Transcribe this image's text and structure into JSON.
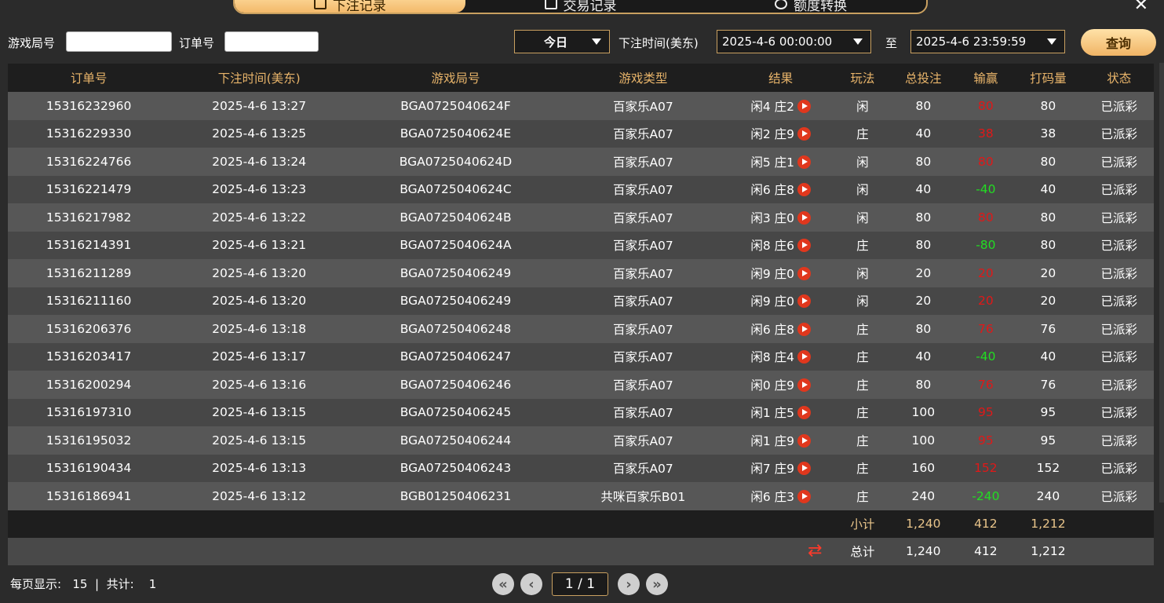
{
  "tabs": [
    {
      "label": "下注记录",
      "icon": "calendar-icon"
    },
    {
      "label": "交易记录",
      "icon": "receipt-icon"
    },
    {
      "label": "额度转换",
      "icon": "exchange-icon"
    }
  ],
  "filters": {
    "game_round_label": "游戏局号",
    "order_no_label": "订单号",
    "range_select": "今日",
    "time_label": "下注时间(美东)",
    "start_time": "2025-4-6 00:00:00",
    "to_label": "至",
    "end_time": "2025-4-6 23:59:59",
    "query_button": "查询"
  },
  "table": {
    "columns": [
      "订单号",
      "下注时间(美东)",
      "游戏局号",
      "游戏类型",
      "结果",
      "玩法",
      "总投注",
      "输赢",
      "打码量",
      "状态"
    ],
    "rows": [
      {
        "order": "15316232960",
        "time": "2025-4-6 13:27",
        "round": "BGA0725040624F",
        "game": "百家乐A07",
        "result": "闲4 庄2",
        "bet_on": "闲",
        "total": "80",
        "winloss": "80",
        "wl_sign": "pos",
        "turnover": "80",
        "status": "已派彩"
      },
      {
        "order": "15316229330",
        "time": "2025-4-6 13:25",
        "round": "BGA0725040624E",
        "game": "百家乐A07",
        "result": "闲2 庄9",
        "bet_on": "庄",
        "total": "40",
        "winloss": "38",
        "wl_sign": "pos",
        "turnover": "38",
        "status": "已派彩"
      },
      {
        "order": "15316224766",
        "time": "2025-4-6 13:24",
        "round": "BGA0725040624D",
        "game": "百家乐A07",
        "result": "闲5 庄1",
        "bet_on": "闲",
        "total": "80",
        "winloss": "80",
        "wl_sign": "pos",
        "turnover": "80",
        "status": "已派彩"
      },
      {
        "order": "15316221479",
        "time": "2025-4-6 13:23",
        "round": "BGA0725040624C",
        "game": "百家乐A07",
        "result": "闲6 庄8",
        "bet_on": "闲",
        "total": "40",
        "winloss": "-40",
        "wl_sign": "neg",
        "turnover": "40",
        "status": "已派彩"
      },
      {
        "order": "15316217982",
        "time": "2025-4-6 13:22",
        "round": "BGA0725040624B",
        "game": "百家乐A07",
        "result": "闲3 庄0",
        "bet_on": "闲",
        "total": "80",
        "winloss": "80",
        "wl_sign": "pos",
        "turnover": "80",
        "status": "已派彩"
      },
      {
        "order": "15316214391",
        "time": "2025-4-6 13:21",
        "round": "BGA0725040624A",
        "game": "百家乐A07",
        "result": "闲8 庄6",
        "bet_on": "庄",
        "total": "80",
        "winloss": "-80",
        "wl_sign": "neg",
        "turnover": "80",
        "status": "已派彩"
      },
      {
        "order": "15316211289",
        "time": "2025-4-6 13:20",
        "round": "BGA07250406249",
        "game": "百家乐A07",
        "result": "闲9 庄0",
        "bet_on": "闲",
        "total": "20",
        "winloss": "20",
        "wl_sign": "pos",
        "turnover": "20",
        "status": "已派彩"
      },
      {
        "order": "15316211160",
        "time": "2025-4-6 13:20",
        "round": "BGA07250406249",
        "game": "百家乐A07",
        "result": "闲9 庄0",
        "bet_on": "闲",
        "total": "20",
        "winloss": "20",
        "wl_sign": "pos",
        "turnover": "20",
        "status": "已派彩"
      },
      {
        "order": "15316206376",
        "time": "2025-4-6 13:18",
        "round": "BGA07250406248",
        "game": "百家乐A07",
        "result": "闲6 庄8",
        "bet_on": "庄",
        "total": "80",
        "winloss": "76",
        "wl_sign": "pos",
        "turnover": "76",
        "status": "已派彩"
      },
      {
        "order": "15316203417",
        "time": "2025-4-6 13:17",
        "round": "BGA07250406247",
        "game": "百家乐A07",
        "result": "闲8 庄4",
        "bet_on": "庄",
        "total": "40",
        "winloss": "-40",
        "wl_sign": "neg",
        "turnover": "40",
        "status": "已派彩"
      },
      {
        "order": "15316200294",
        "time": "2025-4-6 13:16",
        "round": "BGA07250406246",
        "game": "百家乐A07",
        "result": "闲0 庄9",
        "bet_on": "庄",
        "total": "80",
        "winloss": "76",
        "wl_sign": "pos",
        "turnover": "76",
        "status": "已派彩"
      },
      {
        "order": "15316197310",
        "time": "2025-4-6 13:15",
        "round": "BGA07250406245",
        "game": "百家乐A07",
        "result": "闲1 庄5",
        "bet_on": "庄",
        "total": "100",
        "winloss": "95",
        "wl_sign": "pos",
        "turnover": "95",
        "status": "已派彩"
      },
      {
        "order": "15316195032",
        "time": "2025-4-6 13:15",
        "round": "BGA07250406244",
        "game": "百家乐A07",
        "result": "闲1 庄9",
        "bet_on": "庄",
        "total": "100",
        "winloss": "95",
        "wl_sign": "pos",
        "turnover": "95",
        "status": "已派彩"
      },
      {
        "order": "15316190434",
        "time": "2025-4-6 13:13",
        "round": "BGA07250406243",
        "game": "百家乐A07",
        "result": "闲7 庄9",
        "bet_on": "庄",
        "total": "160",
        "winloss": "152",
        "wl_sign": "pos",
        "turnover": "152",
        "status": "已派彩"
      },
      {
        "order": "15316186941",
        "time": "2025-4-6 13:12",
        "round": "BGB01250406231",
        "game": "共咪百家乐B01",
        "result": "闲6 庄3",
        "bet_on": "庄",
        "total": "240",
        "winloss": "-240",
        "wl_sign": "neg",
        "turnover": "240",
        "status": "已派彩"
      }
    ],
    "subtotal": {
      "label": "小计",
      "total": "1,240",
      "winloss": "412",
      "turnover": "1,212"
    },
    "grand_total": {
      "label": "总计",
      "total": "1,240",
      "winloss": "412",
      "turnover": "1,212"
    }
  },
  "footer": {
    "per_page_label": "每页显示:",
    "per_page": "15",
    "separator": "|",
    "total_label": "共计:",
    "total_count": "1"
  },
  "pager": {
    "current": "1",
    "sep": "/",
    "pages": "1"
  },
  "colors": {
    "accent": "#e8b46a",
    "win": "#e01818",
    "loss": "#22dd22"
  }
}
